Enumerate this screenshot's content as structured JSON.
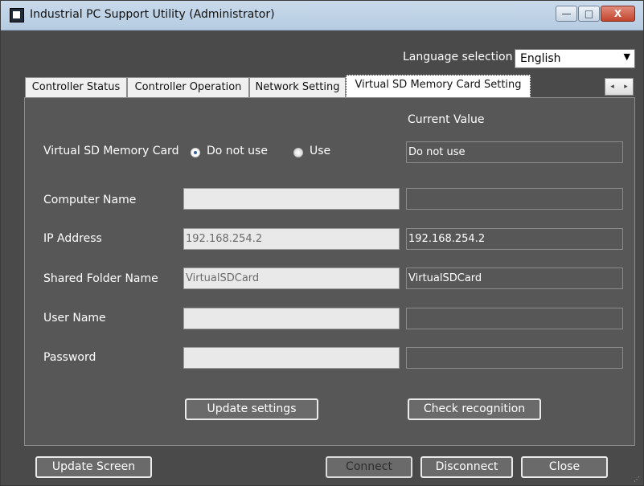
{
  "window": {
    "title": "Industrial PC Support Utility (Administrator)",
    "controls": {
      "minimize": "—",
      "maximize": "□",
      "close": "X"
    }
  },
  "language": {
    "label": "Language selection",
    "value": "English"
  },
  "tabs": [
    {
      "label": "Controller Status"
    },
    {
      "label": "Controller Operation"
    },
    {
      "label": "Network Setting"
    },
    {
      "label": "Virtual SD Memory Card Setting",
      "active": true
    }
  ],
  "tab_scroll": {
    "left": "◂",
    "right": "▸"
  },
  "settings": {
    "current_value_header": "Current Value",
    "sd_card": {
      "label": "Virtual SD Memory Card",
      "options": [
        "Do not use",
        "Use"
      ],
      "selected": "Do not use",
      "current": "Do not use"
    },
    "computer_name": {
      "label": "Computer Name",
      "value": "",
      "current": ""
    },
    "ip_address": {
      "label": "IP Address",
      "value": "192.168.254.2",
      "current": "192.168.254.2"
    },
    "shared_folder": {
      "label": "Shared Folder Name",
      "value": "VirtualSDCard",
      "current": "VirtualSDCard"
    },
    "user_name": {
      "label": "User Name",
      "value": "",
      "current": ""
    },
    "password": {
      "label": "Password",
      "value": "",
      "current": ""
    },
    "update_settings_label": "Update settings",
    "check_recognition_label": "Check recognition"
  },
  "footer": {
    "update_screen_label": "Update Screen",
    "connect_label": "Connect",
    "disconnect_label": "Disconnect",
    "close_label": "Close"
  }
}
